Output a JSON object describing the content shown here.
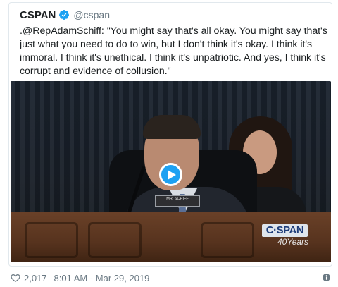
{
  "tweet": {
    "name": "CSPAN",
    "handle": "@cspan",
    "text": ".@RepAdamSchiff: \"You might say that's all okay. You might say that's just what you need to do to win, but I don't think it's okay. I think it's immoral. I think it's unethical. I think it's unpatriotic. And yes, I think it's corrupt and evidence of collusion.\"",
    "likes": "2,017",
    "timestamp": "8:01 AM - Mar 29, 2019"
  },
  "video": {
    "nameplate": "MR. SCHIFF",
    "logo_top": "C·SPAN",
    "logo_bottom": "40Years"
  },
  "icons": {
    "verified": "verified-badge-icon",
    "play": "play-icon",
    "like": "heart-icon",
    "info": "info-icon"
  },
  "colors": {
    "accent": "#1da1f2",
    "text": "#1c2022",
    "muted": "#697882"
  }
}
